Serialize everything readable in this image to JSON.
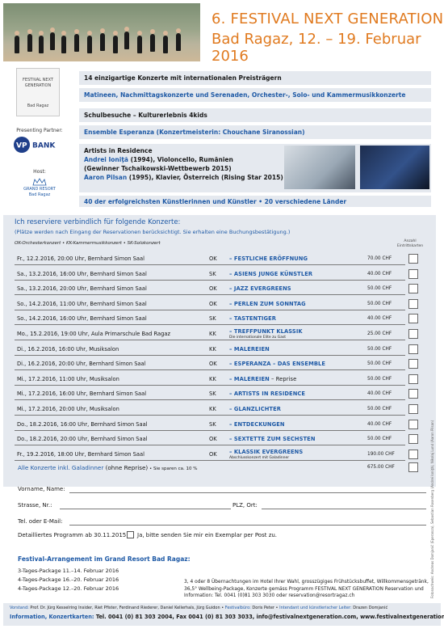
{
  "header": {
    "title_line1": "6. FESTIVAL NEXT GENERATION",
    "title_line2": "Bad Ragaz, 12. – 19. Februar 2016"
  },
  "left": {
    "logo_name": "FESTIVAL NEXT GENERATION",
    "logo_place": "Bad Ragaz",
    "partner_label": "Presenting Partner:",
    "partner_logo": "VPBANK",
    "host_label": "Host:",
    "host_name": "GRAND RESORT",
    "host_place": "Bad Ragaz"
  },
  "info": {
    "line1": "14 einzigartige Konzerte mit internationalen Preisträgern",
    "line2": "Matineen, Nachmittagskonzerte und Serenaden, Orchester-, Solo- und Kammermusikkonzerte",
    "line3": "Schulbesuche – Kulturerlebnis 4kids",
    "line4": "Ensemble Esperanza (Konzertmeisterin: Chouchane Siranossian)",
    "artists_title": "Artists in Residence",
    "artist1_name": "Andrei Ioniţă",
    "artist1_rest": " (1994), Violoncello, Rumänien",
    "artist1_note": "(Gewinner Tschaikowski-Wettbewerb 2015)",
    "artist2_name": "Aaron Pilsan",
    "artist2_rest": " (1995), Klavier, Österreich (Rising Star 2015)",
    "stats": "40 der erfolgreichsten Künstlerinnen und Künstler • 20 verschiedene Länder"
  },
  "reservation": {
    "title": "Ich reserviere verbindlich für folgende Konzerte:",
    "subtitle": "(Plätze werden nach Eingang der Reservationen berücksichtigt. Sie erhalten eine Buchungsbestätigung.)",
    "legend": "OK-Orchesterkonzert • KK-Kammermusikkonzert • SK-Solokonzert",
    "col_anzahl": "Anzahl Eintrittskarten",
    "concerts": [
      {
        "when": "Fr., 12.2.2016, 20:00 Uhr, Bernhard Simon Saal",
        "type": "OK",
        "title": "FESTLICHE ERÖFFNUNG",
        "price": "70.00 CHF"
      },
      {
        "when": "Sa., 13.2.2016, 16:00 Uhr, Bernhard Simon Saal",
        "type": "SK",
        "title": "ASIENS JUNGE KÜNSTLER",
        "price": "40.00 CHF"
      },
      {
        "when": "Sa., 13.2.2016, 20:00 Uhr, Bernhard Simon Saal",
        "type": "OK",
        "title": "JAZZ EVERGREENS",
        "price": "50.00 CHF"
      },
      {
        "when": "So., 14.2.2016, 11:00 Uhr, Bernhard Simon Saal",
        "type": "OK",
        "title": "PERLEN ZUM SONNTAG",
        "price": "50.00 CHF"
      },
      {
        "when": "So., 14.2.2016, 16:00 Uhr, Bernhard Simon Saal",
        "type": "SK",
        "title": "TASTENTIGER",
        "price": "40.00 CHF"
      },
      {
        "when": "Mo., 15.2.2016, 19:00 Uhr, Aula Primarschule Bad Ragaz",
        "type": "KK",
        "title": "TREFFPUNKT KLASSIK",
        "sub": "Die internationale Elite zu Gast",
        "price": "25.00 CHF"
      },
      {
        "when": "Di., 16.2.2016, 16:00 Uhr, Musiksalon",
        "type": "KK",
        "title": "MALEREIEN",
        "price": "50.00 CHF"
      },
      {
        "when": "Di., 16.2.2016, 20:00 Uhr, Bernhard Simon Saal",
        "type": "OK",
        "title": "ESPERANZA – DAS ENSEMBLE",
        "price": "50.00 CHF"
      },
      {
        "when": "Mi., 17.2.2016, 11:00 Uhr, Musiksalon",
        "type": "KK",
        "title": "MALEREIEN",
        "extra": " – Reprise",
        "price": "50.00 CHF"
      },
      {
        "when": "Mi., 17.2.2016, 16:00 Uhr, Bernhard Simon Saal",
        "type": "SK",
        "title": "ARTISTS IN RESIDENCE",
        "price": "40.00 CHF"
      },
      {
        "when": "Mi., 17.2.2016, 20:00 Uhr, Musiksalon",
        "type": "KK",
        "title": "GLANZLICHTER",
        "price": "50.00 CHF"
      },
      {
        "when": "Do., 18.2.2016, 16:00 Uhr, Bernhard Simon Saal",
        "type": "SK",
        "title": "ENTDECKUNGEN",
        "price": "40.00 CHF"
      },
      {
        "when": "Do., 18.2.2016, 20:00 Uhr, Bernhard Simon Saal",
        "type": "OK",
        "title": "SEXTETTE ZUM SECHSTEN",
        "price": "50.00 CHF"
      },
      {
        "when": "Fr., 19.2.2016, 18:00 Uhr, Bernhard Simon Saal",
        "type": "OK",
        "title": "KLASSIK EVERGREENS",
        "sub": "Abschlusskonzert mit Galadinner",
        "price": "190.00 CHF"
      }
    ],
    "all_label": "Alle Konzerte inkl. Galadinner",
    "all_note": " (ohne Reprise)",
    "all_savings": " • Sie sparen ca. 10 %",
    "all_price": "675.00 CHF"
  },
  "form": {
    "name_label": "Vorname, Name:",
    "street_label": "Strasse, Nr.:",
    "zip_label": "PLZ, Ort:",
    "phone_label": "Tel. oder E-Mail:",
    "program_label": "Detailliertes Programm ab 30.11.2015:",
    "program_option": "Ja, bitte senden Sie mir ein Exemplar per Post zu."
  },
  "arrangement": {
    "title": "Festival-Arrangement im Grand Resort Bad Ragaz:",
    "packages": [
      "3-Tages-Package 11.–14. Februar 2016",
      "4-Tages-Package 16.–20. Februar 2016",
      "4-Tages-Package 12.–20. Februar 2016"
    ],
    "description": "3, 4 oder 8 Übernachtungen im Hotel Ihrer Wahl, grosszügiges Frühstücksbuffet, Willkommensgetränk, 36,5° Wellbeing-Package, Konzerte gemäss Programm FESTIVAL NEXT GENERATION Reservation und Information: Tel. 0041 (0)81 303 3030 oder reservation@resortragaz.ch"
  },
  "footer": {
    "board_label": "Vorstand:",
    "board": " Prof. Dr. Jürg Kesselring Insider, Riet Pfister, Ferdinand Riederer, Daniel Kellerhals, Jürg Guidon •",
    "office_label": " Festivalbüro:",
    "office": " Doris Peter •",
    "director_label": " Intendant und künstlerischer Leiter:",
    "director": " Drazen Domjanić",
    "contact_label": "Information, Konzertkarten:",
    "contact": " Tel. 0041 (0) 81 303 2004, Fax 0041 (0) 81 303 3033, info@festivalnextgeneration.com, www.festivalnextgeneration.com"
  },
  "credit": "Fotonachweis: Andreas Domjanić (Eperanza), Sebastian Rosenberg (Andrei Ioniţă), Nikolaj Lund (Aaron Pilsan)"
}
